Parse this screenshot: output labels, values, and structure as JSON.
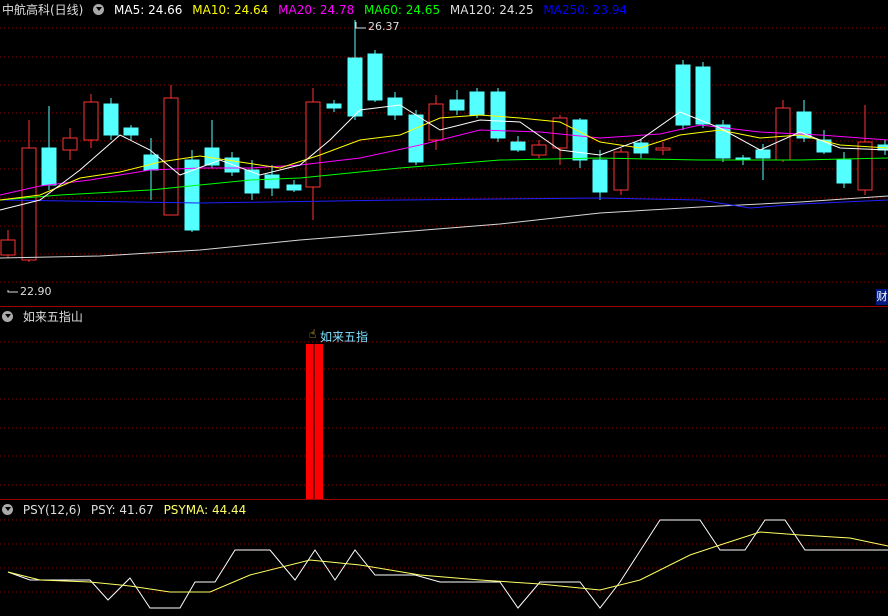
{
  "header": {
    "stock": "中航高科(日线)",
    "ma": [
      {
        "label": "MA5: 24.66",
        "color": "#ffffff"
      },
      {
        "label": "MA10: 24.64",
        "color": "#ffff00"
      },
      {
        "label": "MA20: 24.78",
        "color": "#ff00ff"
      },
      {
        "label": "MA60: 24.65",
        "color": "#00ff00"
      },
      {
        "label": "MA120: 24.25",
        "color": "#dddddd"
      },
      {
        "label": "MA250: 23.94",
        "color": "#0000ff"
      }
    ]
  },
  "price": {
    "high_label": "26.37",
    "low_label": "22.90",
    "fin_badge": "财"
  },
  "indicator": {
    "title": "如来五指山",
    "signal_label": "如来五指",
    "signal_color": "#ff0000"
  },
  "psy": {
    "title": "PSY(12,6)",
    "psy_label": "PSY: 41.67",
    "psyma_label": "PSYMA: 44.44",
    "psy_color": "#ffffff",
    "psyma_color": "#ffff66"
  },
  "colors": {
    "up": "#ff3333",
    "down": "#54ffff",
    "grid": "#8b0000"
  }
}
